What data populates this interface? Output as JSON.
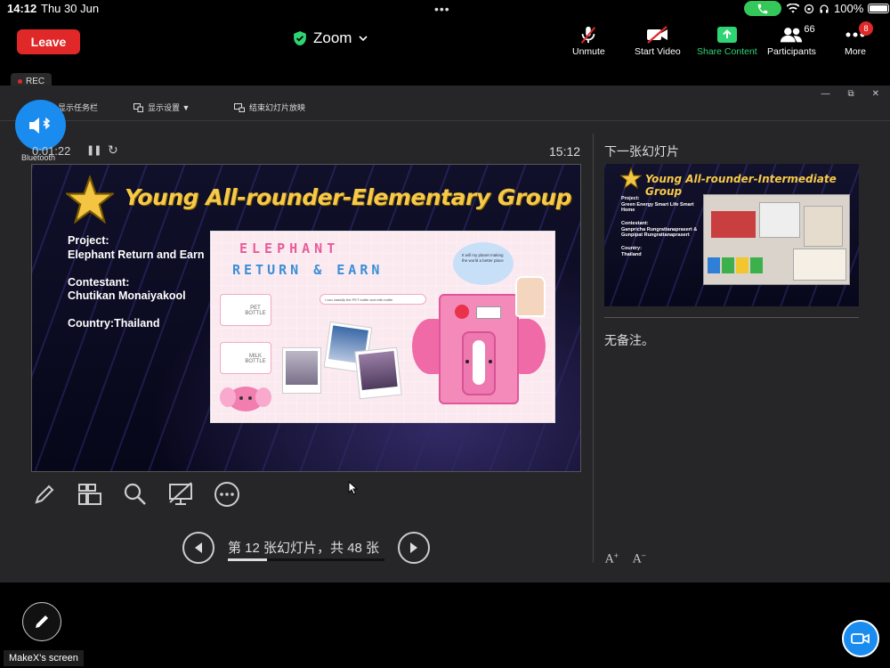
{
  "status_bar": {
    "time": "14:12",
    "date": "Thu 30 Jun",
    "battery": "100%"
  },
  "toolbar": {
    "leave_label": "Leave",
    "app_title": "Zoom",
    "unmute_label": "Unmute",
    "start_video_label": "Start Video",
    "share_content_label": "Share Content",
    "participants_label": "Participants",
    "participants_count": "66",
    "more_label": "More",
    "more_badge": "8"
  },
  "rec_label": "REC",
  "bluetooth_label": "Bluetooth",
  "presenter": {
    "menu_taskbar": "显示任务栏",
    "menu_display": "显示设置 ▼",
    "menu_end": "结束幻灯片放映",
    "timer": "0:01:22",
    "clock": "15:12",
    "slide_counter": "第 12 张幻灯片，共 48 张",
    "progress_fraction": 0.25,
    "next_slide_label": "下一张幻灯片",
    "notes": "无备注。"
  },
  "current_slide": {
    "title": "Young All-rounder-Elementary Group",
    "project_label": "Project:",
    "project": "Elephant Return and Earn",
    "contestant_label": "Contestant:",
    "contestant": "Chutikan Monaiyakool",
    "country": "Country:Thailand",
    "poster_line1": "ELEPHANT",
    "poster_line2": "RETURN & EARN",
    "poster_caption": "I can classify the PET bottle and milk bottle",
    "poster_bubble": "It will my planet making the world a better place",
    "poster_pet": "PET BOTTLE",
    "poster_milk": "MILK BOTTLE"
  },
  "next_slide": {
    "title": "Young All-rounder-Intermediate Group",
    "project": "Project:\nGreen Energy Smart Life Smart Home",
    "contestant": "Contestant:\nGanpricha Rungrattanaprasert & Gunpipat Rungrattanaprasert",
    "country": "Country:\nThailand"
  },
  "screen_owner_label": "MakeX's screen"
}
